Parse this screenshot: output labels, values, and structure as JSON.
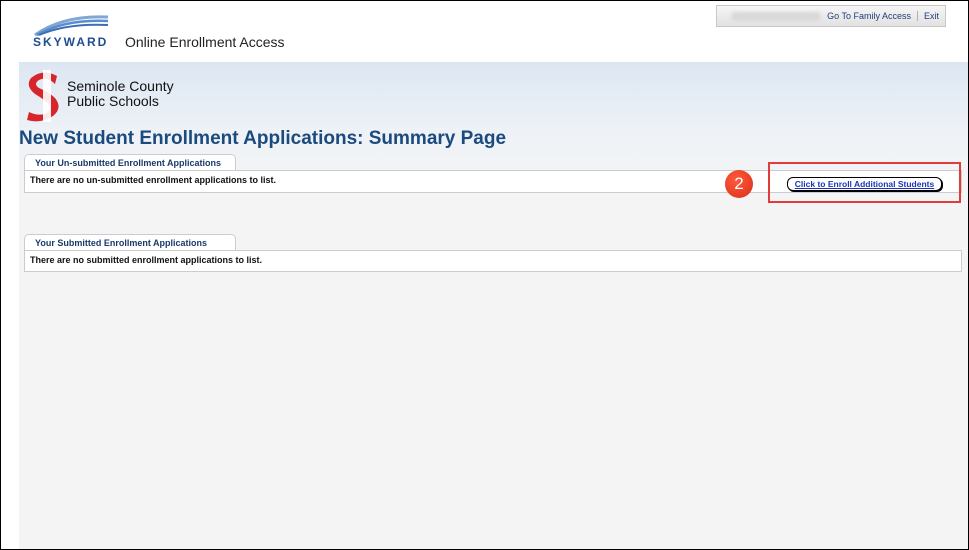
{
  "header": {
    "logo_text": "SKYWARD",
    "app_title": "Online Enrollment Access",
    "links": [
      {
        "label": "Go To Family Access"
      },
      {
        "label": "Exit"
      }
    ]
  },
  "district": {
    "line1": "Seminole County",
    "line2": "Public Schools",
    "logo_letter": "S"
  },
  "page": {
    "title": "New Student Enrollment Applications: Summary Page"
  },
  "unsubmitted": {
    "tab_label": "Your Un-submitted Enrollment Applications",
    "empty_text": "There are no un-submitted enrollment applications to list.",
    "enroll_button": "Click to Enroll Additional Students",
    "step_badge": "2"
  },
  "submitted": {
    "tab_label": "Your Submitted Enrollment Applications",
    "empty_text": "There are no submitted enrollment applications to list."
  },
  "colors": {
    "title": "#1a4a7e",
    "highlight": "#e23b3b",
    "link": "#1a35b8"
  }
}
